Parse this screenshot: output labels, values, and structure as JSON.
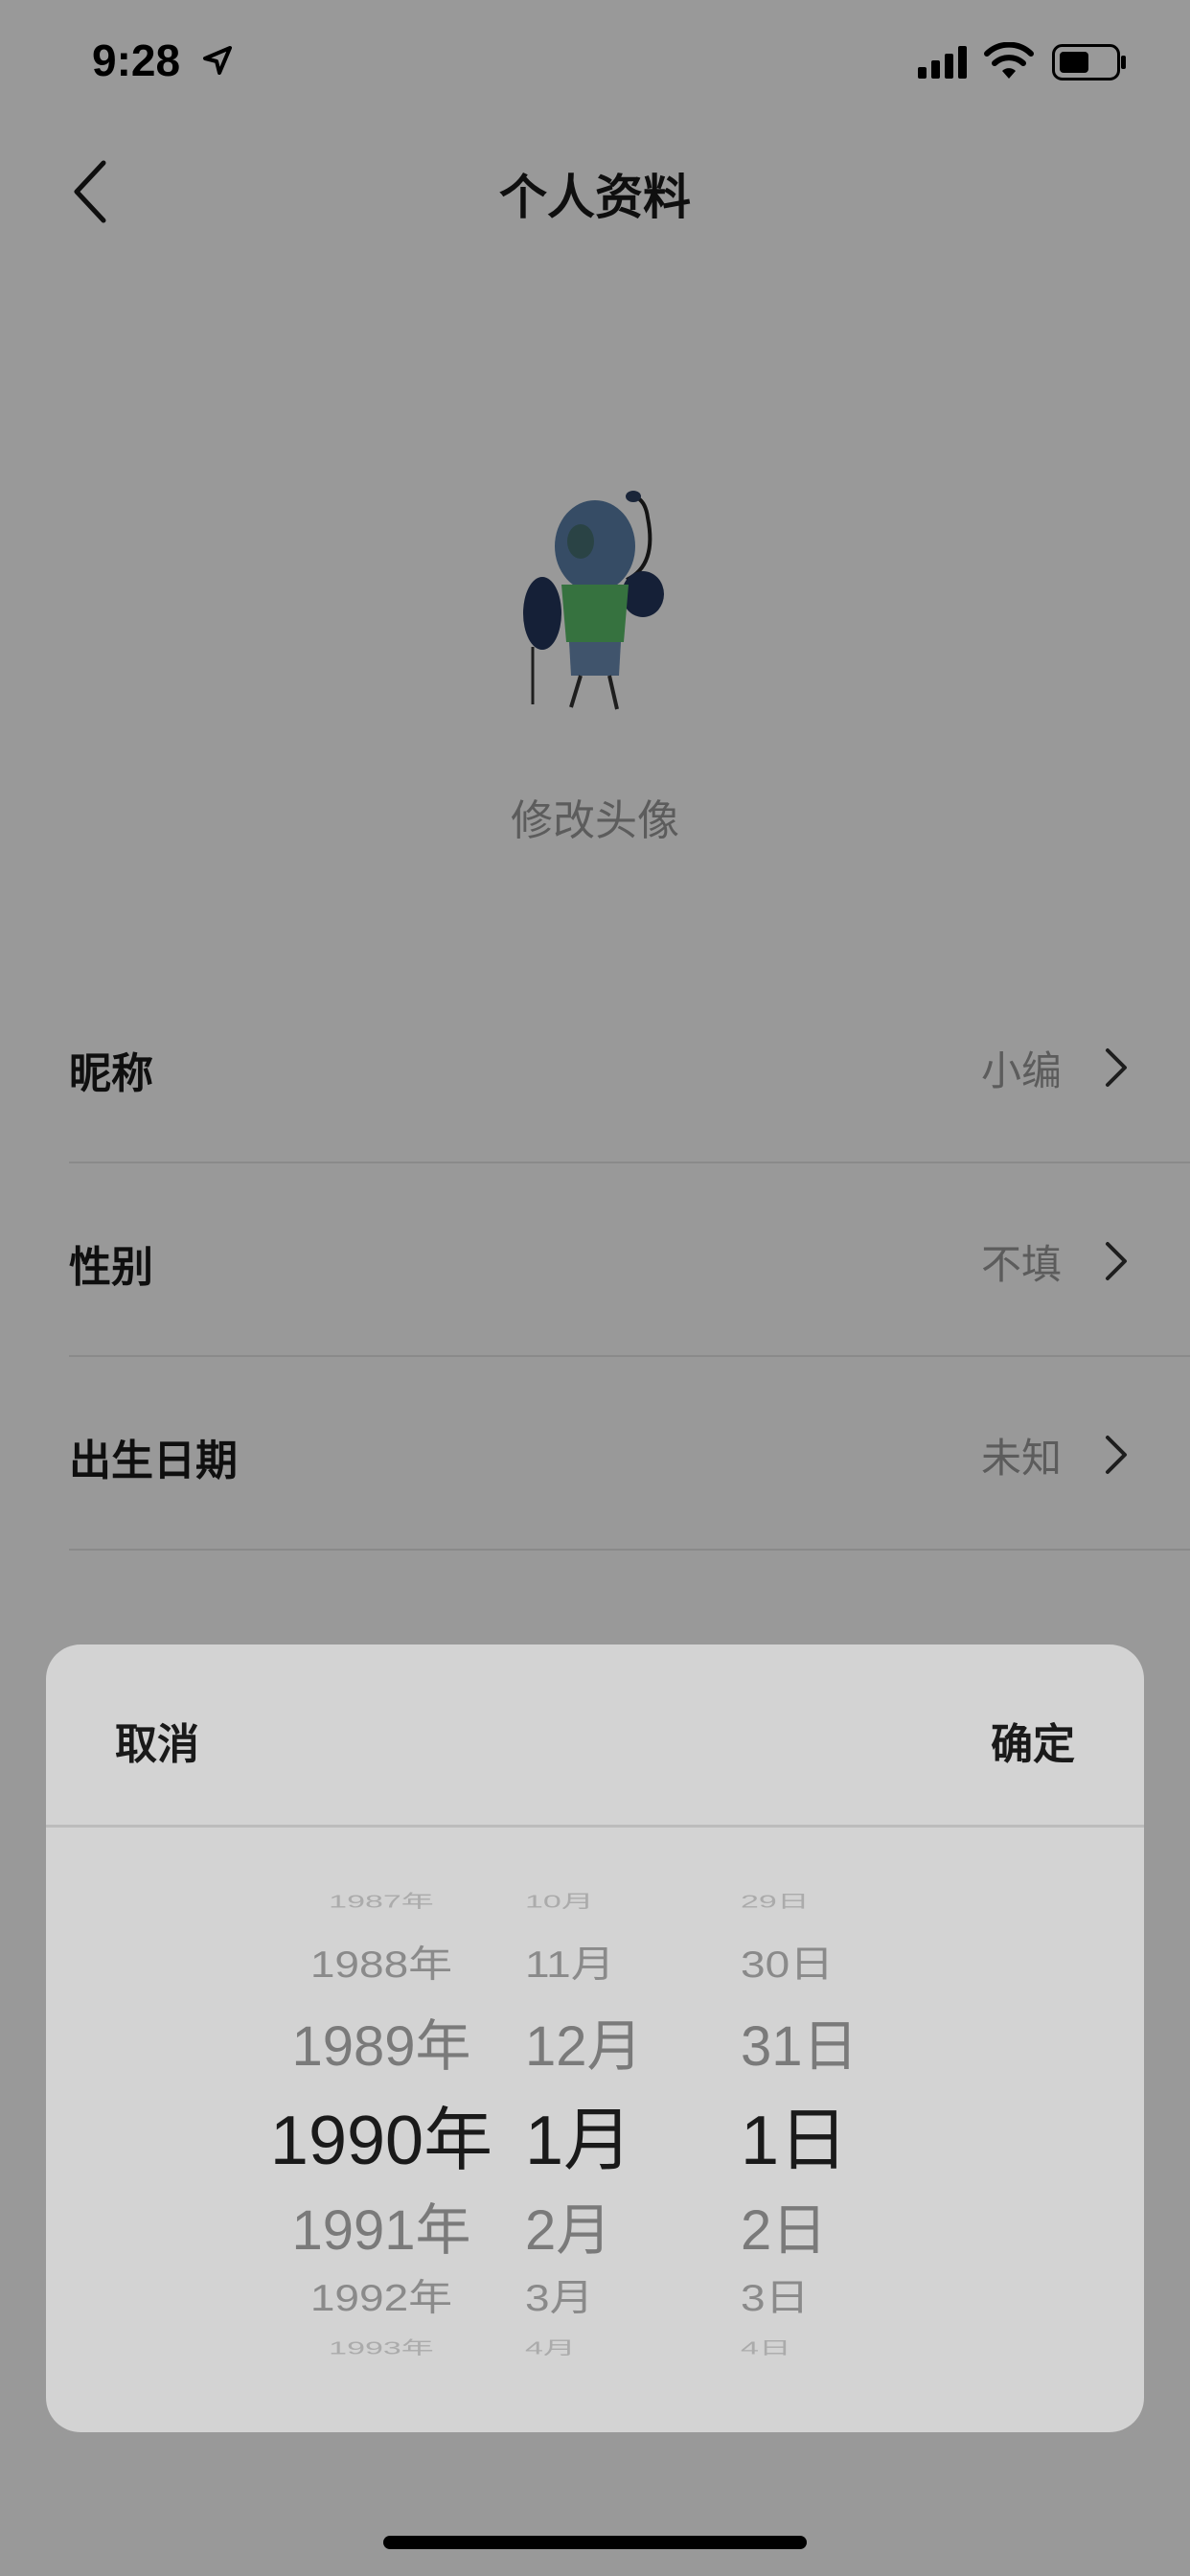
{
  "status_bar": {
    "time": "9:28",
    "location_icon": "location-arrow-icon",
    "signal_icon": "cellular-signal-icon",
    "wifi_icon": "wifi-icon",
    "battery_icon": "battery-icon"
  },
  "nav": {
    "title": "个人资料",
    "back_icon": "chevron-left-icon"
  },
  "avatar": {
    "label": "修改头像"
  },
  "rows": [
    {
      "label": "昵称",
      "value": "小编"
    },
    {
      "label": "性别",
      "value": "不填"
    },
    {
      "label": "出生日期",
      "value": "未知"
    }
  ],
  "picker": {
    "cancel_label": "取消",
    "confirm_label": "确定",
    "years": [
      "1987年",
      "1988年",
      "1989年",
      "1990年",
      "1991年",
      "1992年",
      "1993年"
    ],
    "months": [
      "10月",
      "11月",
      "12月",
      "1月",
      "2月",
      "3月",
      "4月"
    ],
    "days": [
      "29日",
      "30日",
      "31日",
      "1日",
      "2日",
      "3日",
      "4日"
    ],
    "selected": {
      "year": "1990年",
      "month": "1月",
      "day": "1日"
    }
  },
  "colors": {
    "overlay": "rgba(0,0,0,0.4)",
    "sheet_background": "#d3d3d3",
    "text_primary": "#1a1a1a",
    "text_secondary": "#9a9a9a"
  }
}
